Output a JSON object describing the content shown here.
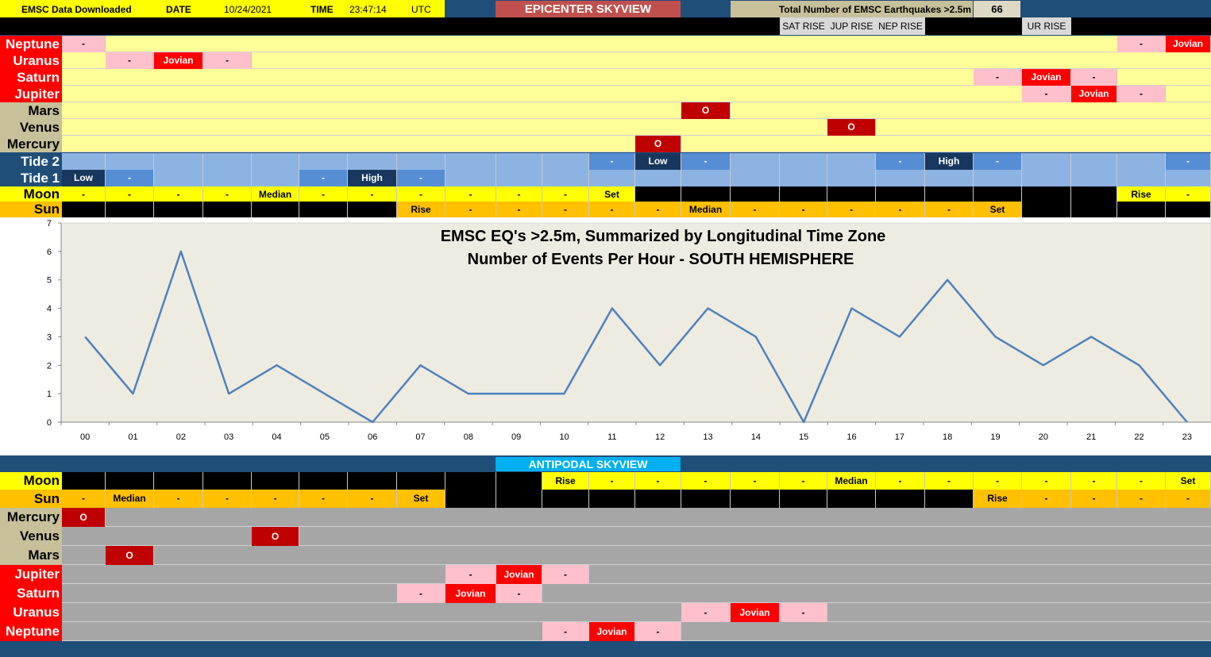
{
  "header": {
    "downloaded_label": "EMSC Data Downloaded",
    "date_label": "DATE",
    "date_value": "10/24/2021",
    "time_label": "TIME",
    "time_value": "23:47:14",
    "tz_value": "UTC",
    "epicenter_title": "EPICENTER SKYVIEW",
    "total_label": "Total Number of EMSC Earthquakes >2.5m",
    "total_value": "66"
  },
  "rise_labels": [
    "SAT RISE",
    "JUP RISE",
    "NEP RISE",
    "UR RISE"
  ],
  "colors": {
    "navy": "#1f4e79",
    "label_red": "#ff0000",
    "label_tan": "#c8c09a",
    "row_yellow": "#ffff99",
    "moon_yellow": "#ffff00",
    "sun_orange": "#ffc000",
    "jovian_red": "#ff0000",
    "pink": "#ffc0cb",
    "conj_red": "#c00000",
    "tide_light": "#8db3e2",
    "tide_mid": "#558ed5",
    "tide_dark": "#17375e",
    "gray": "#a6a6a6",
    "cyan": "#00b0f0",
    "plot_bg": "#eeece1",
    "line": "#4f81bd"
  },
  "epicenter_rows": [
    {
      "label": "Neptune",
      "label_style": "red",
      "base": "yellow",
      "cells": {
        "0": [
          "pink",
          "-"
        ],
        "22": [
          "pink",
          "-"
        ],
        "23": [
          "red",
          "Jovian"
        ]
      }
    },
    {
      "label": "Uranus",
      "label_style": "red",
      "base": "yellow",
      "cells": {
        "1": [
          "pink",
          "-"
        ],
        "2": [
          "red",
          "Jovian"
        ],
        "3": [
          "pink",
          "-"
        ]
      }
    },
    {
      "label": "Saturn",
      "label_style": "red",
      "base": "yellow",
      "cells": {
        "19": [
          "pink",
          "-"
        ],
        "20": [
          "red",
          "Jovian"
        ],
        "21": [
          "pink",
          "-"
        ]
      }
    },
    {
      "label": "Jupiter",
      "label_style": "red",
      "base": "yellow",
      "cells": {
        "20": [
          "pink",
          "-"
        ],
        "21": [
          "red",
          "Jovian"
        ],
        "22": [
          "pink",
          "-"
        ]
      }
    },
    {
      "label": "Mars",
      "label_style": "tan",
      "base": "yellow",
      "cells": {
        "13": [
          "conj",
          "O"
        ]
      }
    },
    {
      "label": "Venus",
      "label_style": "tan",
      "base": "yellow",
      "cells": {
        "16": [
          "conj",
          "O"
        ]
      }
    },
    {
      "label": "Mercury",
      "label_style": "tan",
      "base": "yellow",
      "cells": {
        "12": [
          "conj",
          "O"
        ]
      }
    }
  ],
  "tide_rows": [
    {
      "label": "Tide 2",
      "cells": {
        "11": [
          "mid",
          "-"
        ],
        "12": [
          "dark",
          "Low"
        ],
        "13": [
          "mid",
          "-"
        ],
        "17": [
          "mid",
          "-"
        ],
        "18": [
          "dark",
          "High"
        ],
        "19": [
          "mid",
          "-"
        ],
        "23": [
          "mid",
          "-"
        ]
      }
    },
    {
      "label": "Tide 1",
      "cells": {
        "0": [
          "dark",
          "Low"
        ],
        "1": [
          "mid",
          "-"
        ],
        "5": [
          "mid",
          "-"
        ],
        "6": [
          "dark",
          "High"
        ],
        "7": [
          "mid",
          "-"
        ]
      }
    }
  ],
  "epicenter_moon": {
    "label": "Moon",
    "cells": [
      "-",
      "-",
      "-",
      "-",
      "Median",
      "-",
      "-",
      "-",
      "-",
      "-",
      "-",
      "Set",
      "",
      "",
      "",
      "",
      "",
      "",
      "",
      "",
      "",
      "",
      "Rise",
      "-"
    ],
    "lit": [
      0,
      1,
      2,
      3,
      4,
      5,
      6,
      7,
      8,
      9,
      10,
      11,
      22,
      23
    ]
  },
  "epicenter_sun": {
    "label": "Sun",
    "cells": [
      "",
      "",
      "",
      "",
      "",
      "",
      "",
      "Rise",
      "-",
      "-",
      "-",
      "-",
      "-",
      "Median",
      "-",
      "-",
      "-",
      "-",
      "-",
      "Set",
      "",
      "",
      "",
      ""
    ],
    "lit": [
      7,
      8,
      9,
      10,
      11,
      12,
      13,
      14,
      15,
      16,
      17,
      18,
      19
    ]
  },
  "chart_data": {
    "type": "line",
    "title": "EMSC EQ's >2.5m, Summarized by Longitudinal Time Zone",
    "subtitle": "Number of Events Per Hour - SOUTH HEMISPHERE",
    "categories": [
      "00",
      "01",
      "02",
      "03",
      "04",
      "05",
      "06",
      "07",
      "08",
      "09",
      "10",
      "11",
      "12",
      "13",
      "14",
      "15",
      "16",
      "17",
      "18",
      "19",
      "20",
      "21",
      "22",
      "23"
    ],
    "values": [
      3,
      1,
      6,
      1,
      2,
      1,
      0,
      2,
      1,
      1,
      1,
      4,
      2,
      4,
      3,
      0,
      4,
      3,
      5,
      3,
      2,
      3,
      2,
      0
    ],
    "yticks": [
      "0",
      "1",
      "2",
      "3",
      "4",
      "5",
      "6",
      "7"
    ],
    "ylim": [
      0,
      7
    ],
    "grid": false,
    "legend": "none"
  },
  "antipodal": {
    "title": "ANTIPODAL SKYVIEW",
    "moon": {
      "label": "Moon",
      "cells": [
        "",
        "",
        "",
        "",
        "",
        "",
        "",
        "",
        "",
        "",
        "Rise",
        "-",
        "-",
        "-",
        "-",
        "-",
        "Median",
        "-",
        "-",
        "-",
        "-",
        "-",
        "-",
        "Set"
      ],
      "lit": [
        10,
        11,
        12,
        13,
        14,
        15,
        16,
        17,
        18,
        19,
        20,
        21,
        22,
        23
      ]
    },
    "sun": {
      "label": "Sun",
      "cells": [
        "-",
        "Median",
        "-",
        "-",
        "-",
        "-",
        "-",
        "Set",
        "",
        "",
        "",
        "",
        "",
        "",
        "",
        "",
        "",
        "",
        "",
        "Rise",
        "-",
        "-",
        "-",
        "-"
      ],
      "lit": [
        0,
        1,
        2,
        3,
        4,
        5,
        6,
        7,
        19,
        20,
        21,
        22,
        23
      ]
    },
    "rows": [
      {
        "label": "Mercury",
        "label_style": "tan",
        "cells": {
          "0": [
            "conj",
            "O"
          ]
        }
      },
      {
        "label": "Venus",
        "label_style": "tan",
        "cells": {
          "4": [
            "conj",
            "O"
          ]
        }
      },
      {
        "label": "Mars",
        "label_style": "tan",
        "cells": {
          "1": [
            "conj",
            "O"
          ]
        }
      },
      {
        "label": "Jupiter",
        "label_style": "red",
        "cells": {
          "8": [
            "pink",
            "-"
          ],
          "9": [
            "red",
            "Jovian"
          ],
          "10": [
            "pink",
            "-"
          ]
        }
      },
      {
        "label": "Saturn",
        "label_style": "red",
        "cells": {
          "7": [
            "pink",
            "-"
          ],
          "8": [
            "red",
            "Jovian"
          ],
          "9": [
            "pink",
            "-"
          ]
        }
      },
      {
        "label": "Uranus",
        "label_style": "red",
        "cells": {
          "13": [
            "pink",
            "-"
          ],
          "14": [
            "red",
            "Jovian"
          ],
          "15": [
            "pink",
            "-"
          ]
        }
      },
      {
        "label": "Neptune",
        "label_style": "red",
        "cells": {
          "10": [
            "pink",
            "-"
          ],
          "11": [
            "red",
            "Jovian"
          ],
          "12": [
            "pink",
            "-"
          ]
        }
      }
    ]
  }
}
